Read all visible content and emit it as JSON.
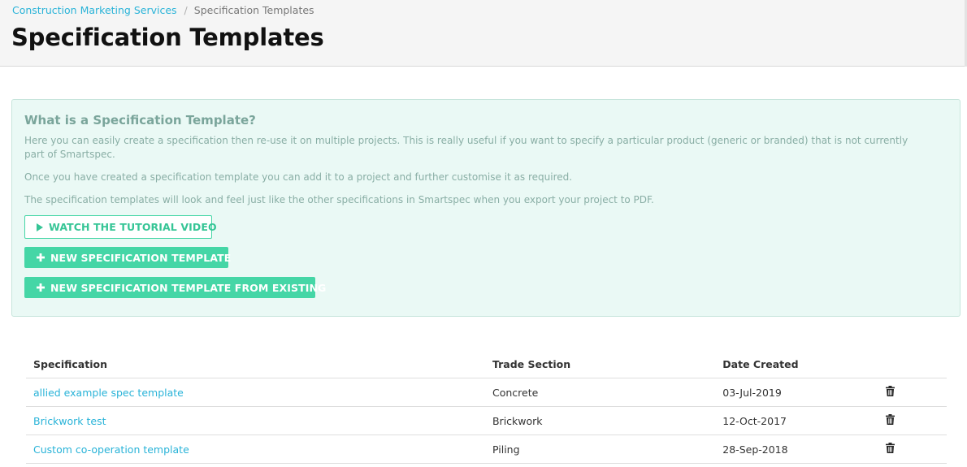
{
  "breadcrumb": {
    "parent": "Construction Marketing Services",
    "separator": "/",
    "current": "Specification Templates"
  },
  "page_title": "Specification Templates",
  "info": {
    "title": "What is a Specification Template?",
    "paragraphs": [
      "Here you can easily create a specification then re-use it on multiple projects. This is really useful if you want to specify a particular product (generic or branded) that is not currently part of Smartspec.",
      "Once you have created a specification template you can add it to a project and further customise it as required.",
      "The specification templates will look and feel just like the other specifications in Smartspec when you export your project to PDF."
    ],
    "buttons": {
      "tutorial": "WATCH THE TUTORIAL VIDEO",
      "new_template": "NEW SPECIFICATION TEMPLATE",
      "new_from_existing": "NEW SPECIFICATION TEMPLATE FROM EXISTING"
    }
  },
  "table": {
    "headers": [
      "Specification",
      "Trade Section",
      "Date Created"
    ],
    "rows": [
      {
        "specification": "allied example spec template",
        "trade_section": "Concrete",
        "date_created": "03-Jul-2019"
      },
      {
        "specification": "Brickwork test",
        "trade_section": "Brickwork",
        "date_created": "12-Oct-2017"
      },
      {
        "specification": "Custom co-operation template",
        "trade_section": "Piling",
        "date_created": "28-Sep-2018"
      }
    ]
  },
  "icons": {
    "play": "play-icon",
    "plus": "plus-icon",
    "delete": "trash-icon"
  },
  "colors": {
    "link": "#29b3d8",
    "accent_green": "#45d6a6",
    "info_background": "#eaf9f5",
    "header_background": "#f5f5f5"
  }
}
